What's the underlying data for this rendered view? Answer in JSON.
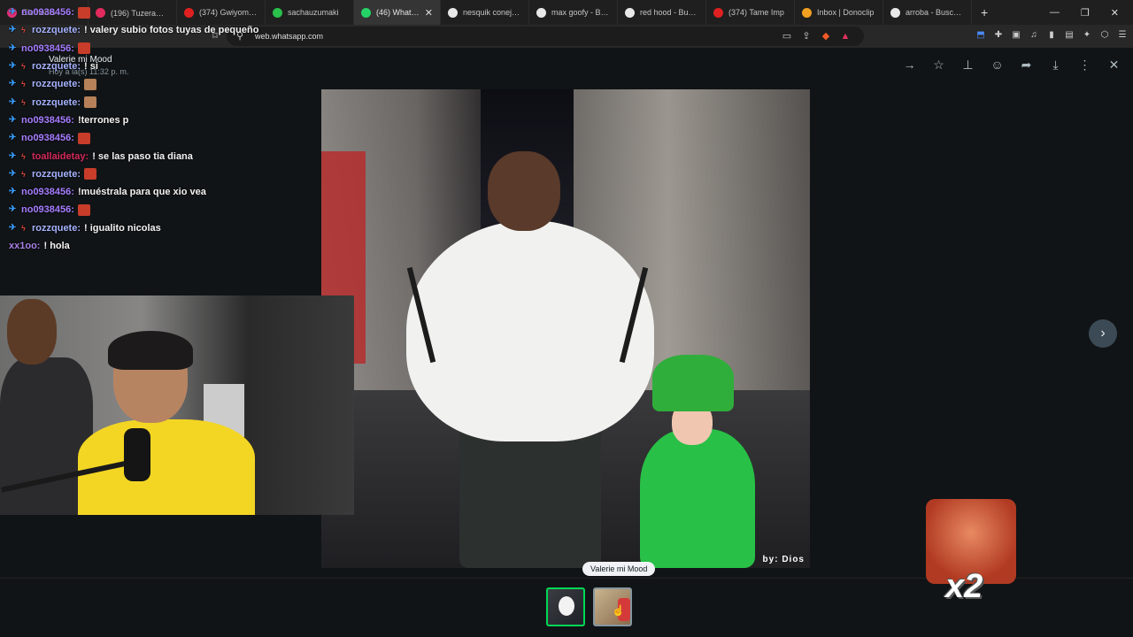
{
  "browser": {
    "tabs": [
      {
        "label": "Elements - ",
        "fav_color": "#e0317a",
        "active": false
      },
      {
        "label": "(196) Tuzera&ミク",
        "fav_color": "#e02b5c",
        "active": false
      },
      {
        "label": "(374) Gwiyomi :3",
        "fav_color": "#e02020",
        "active": false
      },
      {
        "label": "sachauzumaki",
        "fav_color": "#29c04b",
        "active": false
      },
      {
        "label": "(46) WhatsApp",
        "fav_color": "#25d366",
        "active": true
      },
      {
        "label": "nesquik conejo - B",
        "fav_color": "#e8e8e8",
        "active": false
      },
      {
        "label": "max goofy - Buscar",
        "fav_color": "#e8e8e8",
        "active": false
      },
      {
        "label": "red hood - Buscar",
        "fav_color": "#e8e8e8",
        "active": false
      },
      {
        "label": "(374) Tame Imp",
        "fav_color": "#e02020",
        "active": false
      },
      {
        "label": "Inbox | Donoclip",
        "fav_color": "#f0a020",
        "active": false
      },
      {
        "label": "arroba - Buscar co",
        "fav_color": "#e8e8e8",
        "active": false
      }
    ],
    "url": "web.whatsapp.com"
  },
  "viewer": {
    "sender_name": "Valerie mi Mood",
    "sender_time": "Hoy a la(s) 11:32 p. m.",
    "watermark": "by: Dios",
    "tooltip": "Valerie mi Mood"
  },
  "chat": [
    {
      "user": "no0938456:",
      "msg": "",
      "user_class": "u-purple",
      "badges": [
        "sword"
      ],
      "emote": "red"
    },
    {
      "user": "rozzquete:",
      "msg": "! valery subio fotos tuyas de pequeño",
      "user_class": "u-blue",
      "badges": [
        "sword",
        "bolt"
      ],
      "emote": ""
    },
    {
      "user": "no0938456:",
      "msg": "",
      "user_class": "u-purple",
      "badges": [
        "sword"
      ],
      "emote": "red"
    },
    {
      "user": "rozzquete:",
      "msg": "! si",
      "user_class": "u-blue",
      "badges": [
        "sword",
        "bolt"
      ],
      "emote": ""
    },
    {
      "user": "rozzquete:",
      "msg": "",
      "user_class": "u-blue",
      "badges": [
        "sword",
        "bolt"
      ],
      "emote": "tan"
    },
    {
      "user": "rozzquete:",
      "msg": "",
      "user_class": "u-blue",
      "badges": [
        "sword",
        "bolt"
      ],
      "emote": "tan"
    },
    {
      "user": "no0938456:",
      "msg": "!terrones p",
      "user_class": "u-purple",
      "badges": [
        "sword"
      ],
      "emote": ""
    },
    {
      "user": "no0938456:",
      "msg": "",
      "user_class": "u-purple",
      "badges": [
        "sword"
      ],
      "emote": "red"
    },
    {
      "user": "toallaidetay:",
      "msg": "! se las paso tia diana",
      "user_class": "u-pink",
      "badges": [
        "sword",
        "bolt"
      ],
      "emote": ""
    },
    {
      "user": "rozzquete:",
      "msg": "",
      "user_class": "u-blue",
      "badges": [
        "sword",
        "bolt"
      ],
      "emote": "red"
    },
    {
      "user": "no0938456:",
      "msg": "!muéstrala para que xio vea",
      "user_class": "u-purple",
      "badges": [
        "sword"
      ],
      "emote": ""
    },
    {
      "user": "no0938456:",
      "msg": "",
      "user_class": "u-purple",
      "badges": [
        "sword"
      ],
      "emote": "red"
    },
    {
      "user": "rozzquete:",
      "msg": "! igualito nicolas",
      "user_class": "u-blue",
      "badges": [
        "sword",
        "bolt"
      ],
      "emote": ""
    },
    {
      "user": "xx1oo:",
      "msg": "! hola",
      "user_class": "u-violet",
      "badges": [],
      "emote": ""
    }
  ],
  "sticker": {
    "label": "x2"
  },
  "icons": {
    "next": "chevron-right-icon",
    "close": "close-icon"
  }
}
